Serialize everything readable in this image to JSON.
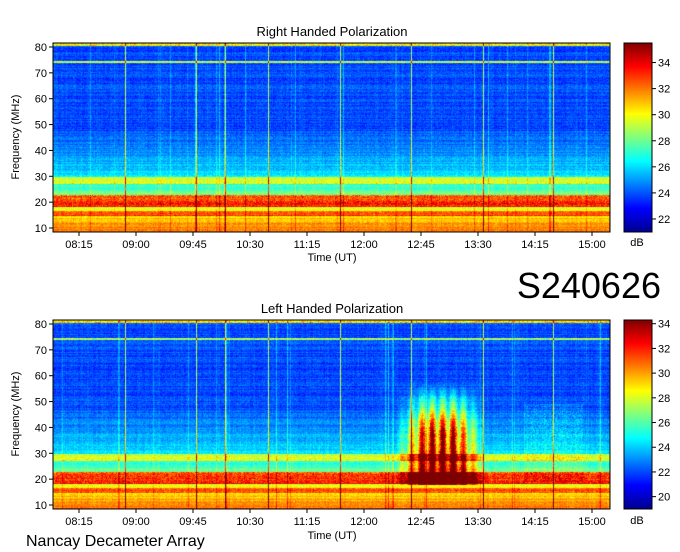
{
  "figure": {
    "code": "S240626",
    "footer": "Nancay Decameter Array"
  },
  "colors": {
    "colormap": [
      "#00008f",
      "#0000ff",
      "#007fff",
      "#00ffff",
      "#7fff7f",
      "#ffff00",
      "#ff7f00",
      "#ff0000",
      "#7f0000"
    ]
  },
  "chart_data": [
    {
      "type": "heatmap",
      "title": "Right Handed Polarization",
      "xlabel": "Time (UT)",
      "ylabel": "Frequency (MHz)",
      "x_ticks": [
        "08:15",
        "09:00",
        "09:45",
        "10:30",
        "11:15",
        "12:00",
        "12:45",
        "13:30",
        "14:15",
        "15:00"
      ],
      "y_ticks": [
        10,
        20,
        30,
        40,
        50,
        60,
        70,
        80
      ],
      "ylim": [
        10,
        80
      ],
      "colorbar": {
        "label": "dB",
        "ticks": [
          22,
          24,
          26,
          28,
          30,
          32,
          34
        ],
        "range": [
          21,
          35.5
        ]
      },
      "notes": "Broadband background noise with strong interference bands near 17-30 MHz and a narrow line near 73 MHz; no burst"
    },
    {
      "type": "heatmap",
      "title": "Left Handed Polarization",
      "xlabel": "Time (UT)",
      "ylabel": "Frequency (MHz)",
      "x_ticks": [
        "08:15",
        "09:00",
        "09:45",
        "10:30",
        "11:15",
        "12:00",
        "12:45",
        "13:30",
        "14:15",
        "15:00"
      ],
      "y_ticks": [
        10,
        20,
        30,
        40,
        50,
        60,
        70,
        80
      ],
      "ylim": [
        10,
        80
      ],
      "colorbar": {
        "label": "dB",
        "ticks": [
          20,
          22,
          24,
          26,
          28,
          30,
          32,
          34
        ],
        "range": [
          19,
          34.3
        ]
      },
      "notes": "Intense emission between about 12:45 and 13:40 UT from about 18 to 55 MHz"
    }
  ]
}
